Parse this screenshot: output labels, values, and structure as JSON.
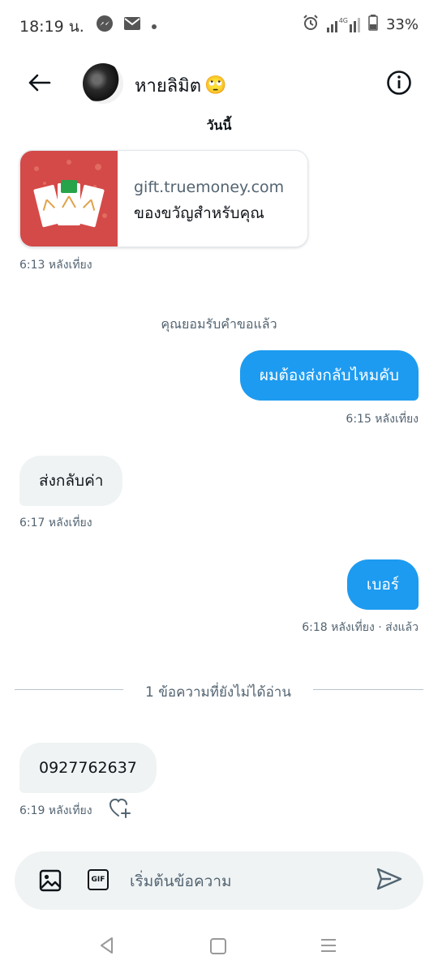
{
  "status_bar": {
    "time": "18:19 น.",
    "network": "4G",
    "battery": "33%",
    "icons": [
      "messenger-icon",
      "mail-icon",
      "dot-icon",
      "alarm-icon",
      "signal-icon",
      "battery-icon"
    ]
  },
  "header": {
    "contact_name": "หายลิมิต",
    "name_emoji": "🙄",
    "icons": [
      "back-arrow-icon",
      "info-icon"
    ]
  },
  "conversation": {
    "date_label": "วันนี้",
    "link_card": {
      "domain": "gift.truemoney.com",
      "title": "ของขวัญสำหรับคุณ",
      "time": "6:13 หลังเที่ยง",
      "image_color": "#d44a48"
    },
    "system_message": "คุณยอมรับคำขอแล้ว",
    "messages": [
      {
        "direction": "outgoing",
        "text": "ผมต้องส่งกลับไหมคับ",
        "time": "6:15 หลังเที่ยง"
      },
      {
        "direction": "incoming",
        "text": "ส่งกลับค่า",
        "time": "6:17 หลังเที่ยง"
      },
      {
        "direction": "outgoing",
        "text": "เบอร์",
        "time": "6:18 หลังเที่ยง · ส่งแล้ว"
      },
      {
        "direction": "incoming",
        "text": "0927762637",
        "time": "6:19 หลังเที่ยง"
      }
    ],
    "unread_divider": "1 ข้อความที่ยังไม่ได้อ่าน"
  },
  "composer": {
    "placeholder": "เริ่มต้นข้อความ",
    "gif_label": "GIF",
    "icons": [
      "image-icon",
      "gif-icon",
      "send-icon"
    ]
  },
  "colors": {
    "accent": "#1d9bf0",
    "incoming_bubble": "#eff3f4",
    "muted_text": "#536471"
  },
  "nav_bar": {
    "icons": [
      "nav-back-icon",
      "nav-home-icon",
      "nav-recents-icon"
    ]
  }
}
